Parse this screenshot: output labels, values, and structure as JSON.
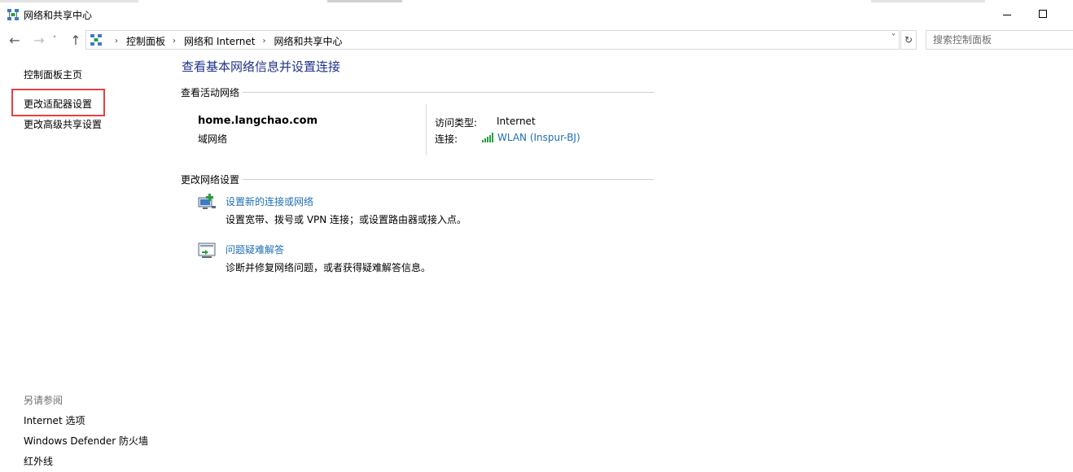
{
  "window": {
    "title": "网络和共享中心",
    "icon": "network-center-icon"
  },
  "navigation": {
    "back_icon": "←",
    "forward_icon": "→",
    "recent_icon": "˅",
    "up_icon": "↑",
    "breadcrumbs": [
      "控制面板",
      "网络和 Internet",
      "网络和共享中心"
    ],
    "separator": "›",
    "dropdown_icon": "˅",
    "refresh_icon": "↻",
    "search_placeholder": "搜索控制面板"
  },
  "left_pane": {
    "home": "控制面板主页",
    "change_adapter": "更改适配器设置",
    "change_sharing": "更改高级共享设置",
    "see_also_title": "另请参阅",
    "see_also": [
      "Internet 选项",
      "Windows Defender 防火墙",
      "红外线"
    ]
  },
  "main": {
    "title": "查看基本网络信息并设置连接",
    "active_networks_header": "查看活动网络",
    "network": {
      "name": "home.langchao.com",
      "category": "域网络",
      "access_type_label": "访问类型:",
      "access_type_value": "Internet",
      "connections_label": "连接:",
      "connection_name": "WLAN (Inspur-BJ)"
    },
    "change_settings_header": "更改网络设置",
    "tasks": [
      {
        "label": "设置新的连接或网络",
        "description": "设置宽带、拨号或 VPN 连接；或设置路由器或接入点。",
        "icon": "new-connection-icon"
      },
      {
        "label": "问题疑难解答",
        "description": "诊断并修复网络问题，或者获得疑难解答信息。",
        "icon": "troubleshoot-icon"
      }
    ]
  },
  "colors": {
    "title_blue": "#1e3287",
    "link_blue": "#1e6fb5",
    "highlight_red": "#e04343",
    "muted_gray": "#6d6d6d"
  }
}
